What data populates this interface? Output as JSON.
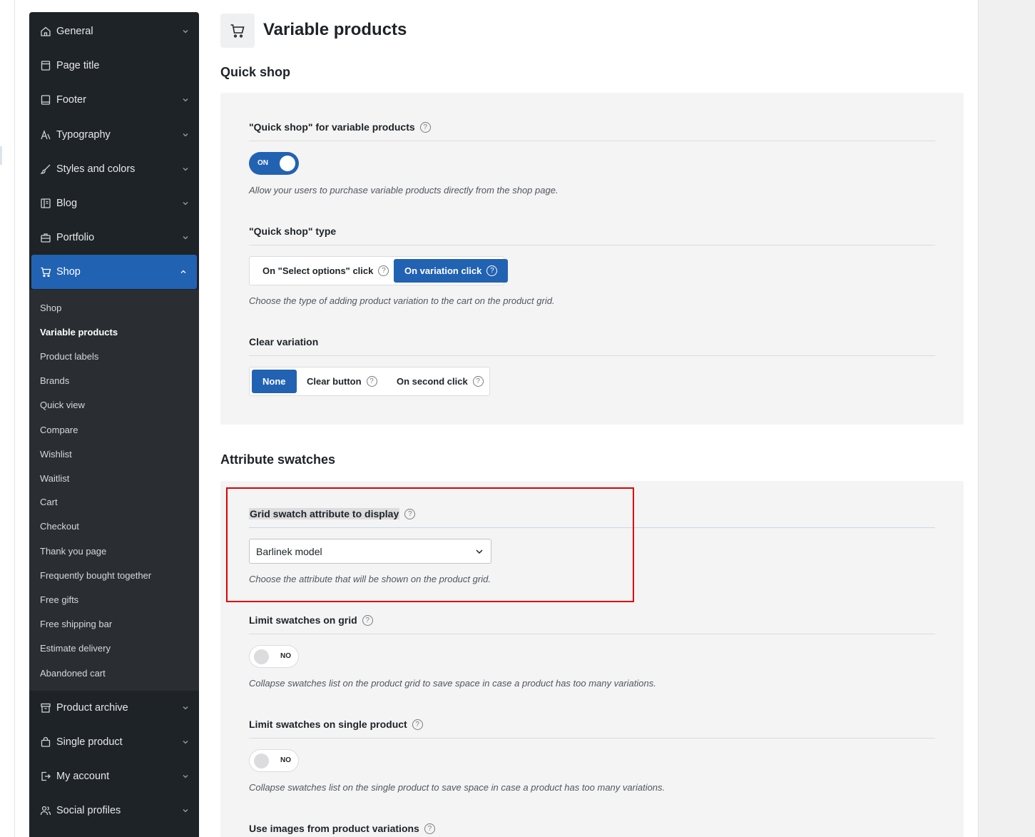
{
  "sidebar": {
    "items": [
      {
        "label": "General",
        "icon": "home-icon"
      },
      {
        "label": "Page title",
        "icon": "page-title-icon"
      },
      {
        "label": "Footer",
        "icon": "footer-icon"
      },
      {
        "label": "Typography",
        "icon": "typography-icon"
      },
      {
        "label": "Styles and colors",
        "icon": "brush-icon"
      },
      {
        "label": "Blog",
        "icon": "blog-icon"
      },
      {
        "label": "Portfolio",
        "icon": "briefcase-icon"
      },
      {
        "label": "Shop",
        "icon": "cart-icon"
      },
      {
        "label": "Product archive",
        "icon": "archive-icon"
      },
      {
        "label": "Single product",
        "icon": "bag-icon"
      },
      {
        "label": "My account",
        "icon": "login-icon"
      },
      {
        "label": "Social profiles",
        "icon": "users-icon"
      }
    ],
    "shop_submenu": [
      "Shop",
      "Variable products",
      "Product labels",
      "Brands",
      "Quick view",
      "Compare",
      "Wishlist",
      "Waitlist",
      "Cart",
      "Checkout",
      "Thank you page",
      "Frequently bought together",
      "Free gifts",
      "Free shipping bar",
      "Estimate delivery",
      "Abandoned cart"
    ],
    "active_item": "Shop",
    "current_subitem": "Variable products",
    "accent_color": "#2262b2"
  },
  "page": {
    "title": "Variable products",
    "icon": "cart-icon"
  },
  "quick_shop": {
    "section_title": "Quick shop",
    "enable": {
      "label": "\"Quick shop\" for variable products",
      "state": "ON",
      "description": "Allow your users to purchase variable products directly from the shop page."
    },
    "type": {
      "label": "\"Quick shop\" type",
      "options": [
        "On \"Select options\" click",
        "On variation click"
      ],
      "selected": "On variation click",
      "description": "Choose the type of adding product variation to the cart on the product grid."
    },
    "clear_variation": {
      "label": "Clear variation",
      "options": [
        "None",
        "Clear button",
        "On second click"
      ],
      "selected": "None"
    }
  },
  "attribute_swatches": {
    "section_title": "Attribute swatches",
    "grid_attribute": {
      "label": "Grid swatch attribute to display",
      "value": "Barlinek model",
      "description": "Choose the attribute that will be shown on the product grid."
    },
    "limit_grid": {
      "label": "Limit swatches on grid",
      "state": "NO",
      "description": "Collapse swatches list on the product grid to save space in case a product has too many variations."
    },
    "limit_single": {
      "label": "Limit swatches on single product",
      "state": "NO",
      "description": "Collapse swatches list on the single product to save space in case a product has too many variations."
    },
    "use_images": {
      "label": "Use images from product variations"
    }
  },
  "help_glyph": "?"
}
